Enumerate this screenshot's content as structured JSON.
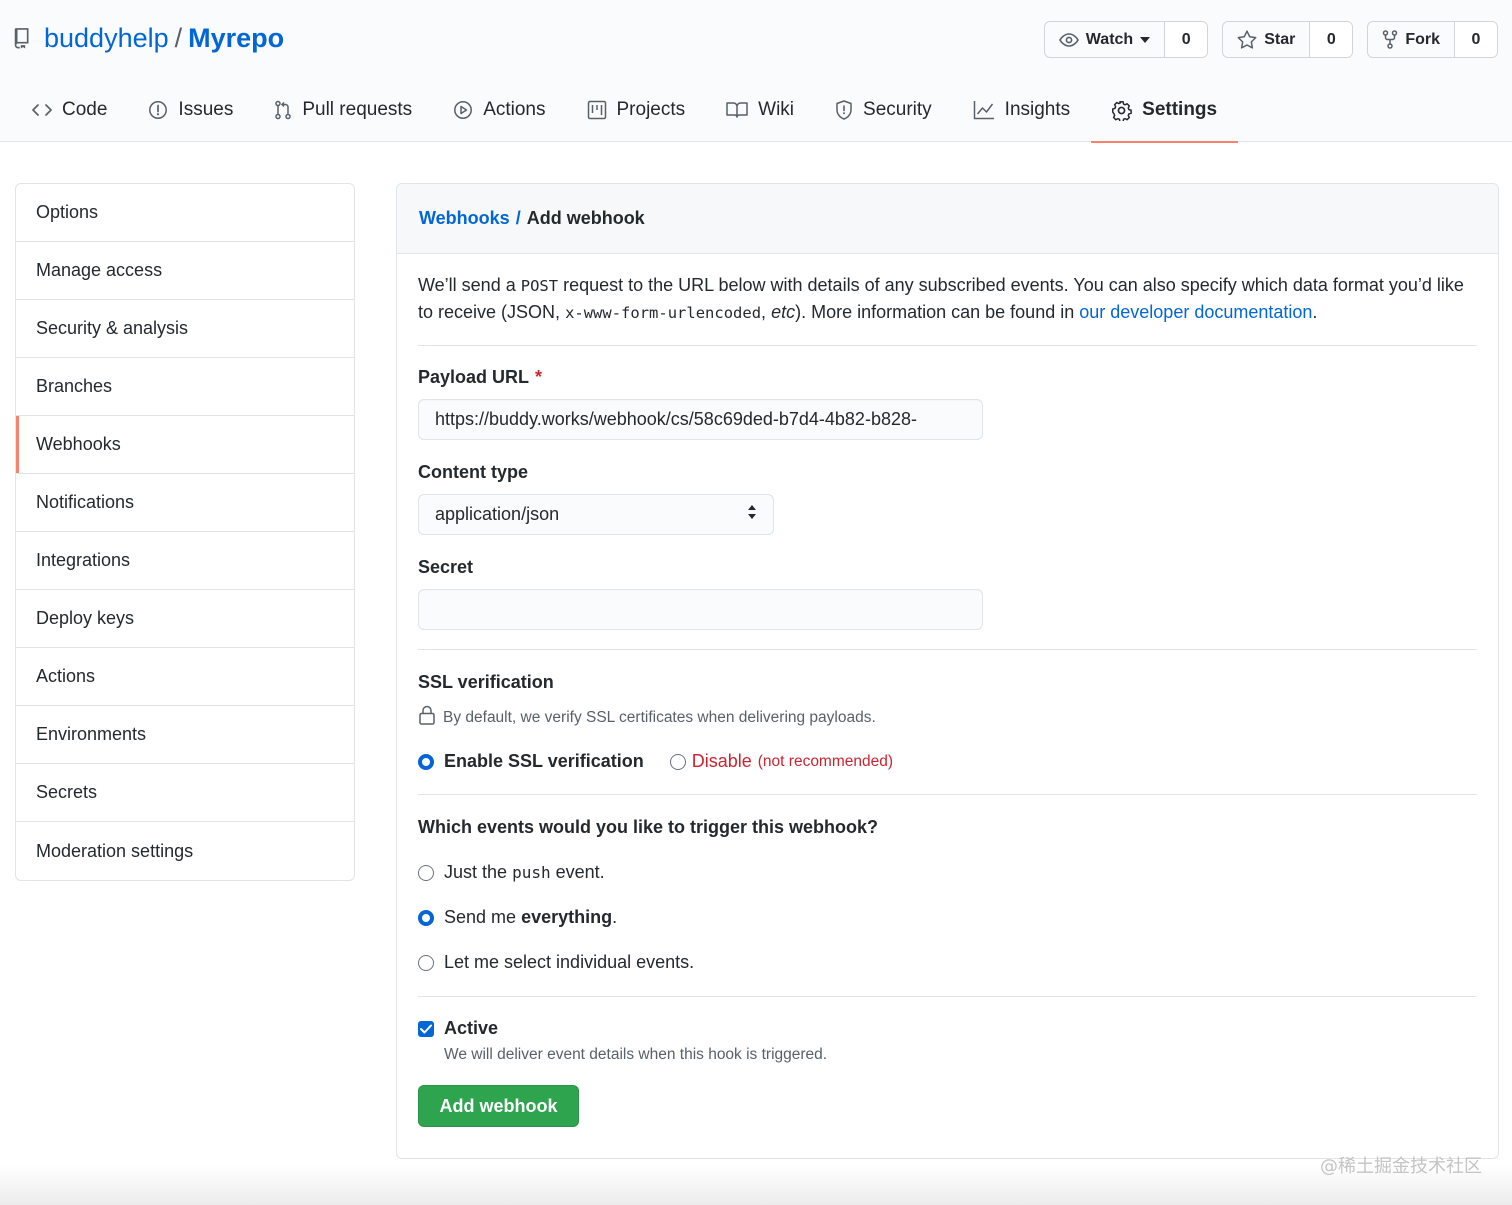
{
  "repo": {
    "owner": "buddyhelp",
    "separator": "/",
    "name": "Myrepo",
    "watch_label": "Watch",
    "watch_count": "0",
    "star_label": "Star",
    "star_count": "0",
    "fork_label": "Fork",
    "fork_count": "0"
  },
  "tabs": [
    {
      "label": "Code",
      "icon": "code-icon"
    },
    {
      "label": "Issues",
      "icon": "issue-icon"
    },
    {
      "label": "Pull requests",
      "icon": "pull-request-icon"
    },
    {
      "label": "Actions",
      "icon": "play-icon"
    },
    {
      "label": "Projects",
      "icon": "project-icon"
    },
    {
      "label": "Wiki",
      "icon": "book-icon"
    },
    {
      "label": "Security",
      "icon": "shield-icon"
    },
    {
      "label": "Insights",
      "icon": "graph-icon"
    },
    {
      "label": "Settings",
      "icon": "gear-icon",
      "selected": true
    }
  ],
  "sidebar": {
    "items": [
      {
        "label": "Options"
      },
      {
        "label": "Manage access"
      },
      {
        "label": "Security & analysis"
      },
      {
        "label": "Branches"
      },
      {
        "label": "Webhooks",
        "selected": true
      },
      {
        "label": "Notifications"
      },
      {
        "label": "Integrations"
      },
      {
        "label": "Deploy keys"
      },
      {
        "label": "Actions"
      },
      {
        "label": "Environments"
      },
      {
        "label": "Secrets"
      },
      {
        "label": "Moderation settings"
      }
    ]
  },
  "page": {
    "breadcrumb_parent": "Webhooks",
    "breadcrumb_sep": "/",
    "title": "Add webhook",
    "intro_1": "We’ll send a",
    "intro_post": "POST",
    "intro_2": "request to the URL below with details of any subscribed events. You can also specify which data format you’d like to receive (JSON,",
    "intro_code": "x-www-form-urlencoded",
    "intro_3": ",",
    "intro_etc": "etc",
    "intro_4": "). More information can be found in",
    "intro_link": "our developer documentation",
    "intro_5": "."
  },
  "form": {
    "payload_label": "Payload URL",
    "payload_required": "*",
    "payload_value": "https://buddy.works/webhook/cs/58c69ded-b7d4-4b82-b828-",
    "content_type_label": "Content type",
    "content_type_value": "application/json",
    "secret_label": "Secret",
    "secret_value": "",
    "ssl_title": "SSL verification",
    "ssl_note": "By default, we verify SSL certificates when delivering payloads.",
    "ssl_enable_label": "Enable SSL verification",
    "ssl_disable_label": "Disable",
    "ssl_disable_note": "(not recommended)",
    "events_title": "Which events would you like to trigger this webhook?",
    "event_push_pre": "Just the",
    "event_push_code": "push",
    "event_push_post": "event.",
    "event_all_pre": "Send me",
    "event_all_bold": "everything",
    "event_all_post": ".",
    "event_select": "Let me select individual events.",
    "active_label": "Active",
    "active_note": "We will deliver event details when this hook is triggered.",
    "submit_label": "Add webhook"
  },
  "watermark": "@稀土掘金技术社区",
  "colors": {
    "link": "#0366d6",
    "accent_underline": "#f9826c",
    "primary_button": "#2ea44f",
    "danger": "#cb2431"
  }
}
